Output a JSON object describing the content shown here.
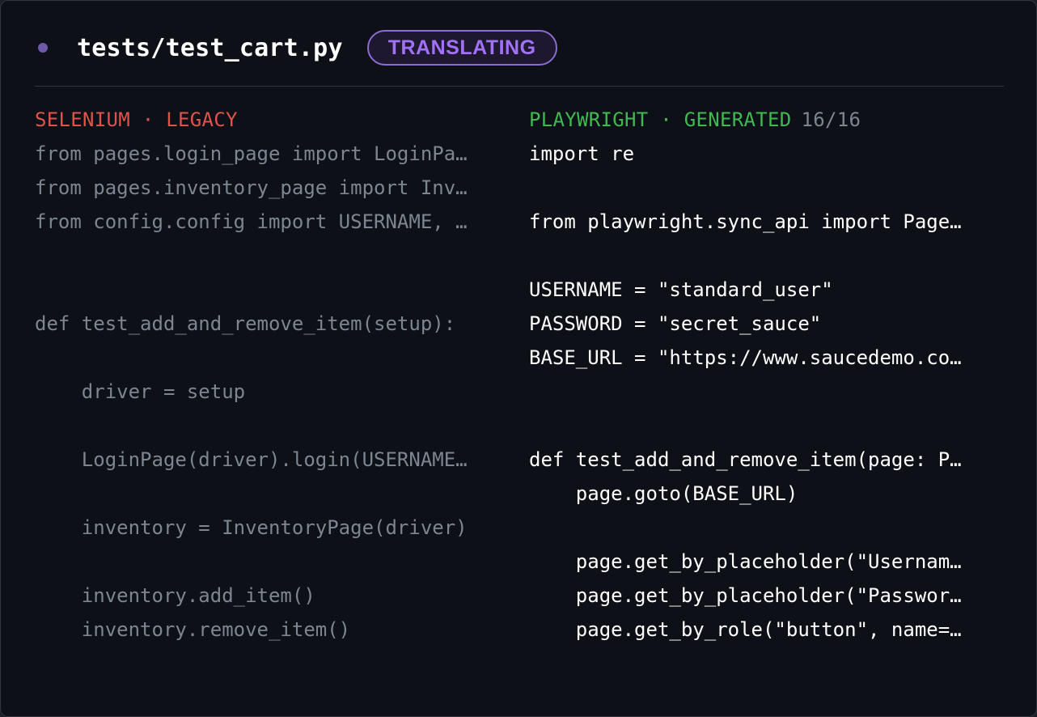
{
  "colors": {
    "accent_purple": "#a371f7",
    "status_dot": "#6e5aa8",
    "badge_border": "#8b6cd0",
    "badge_bg": "#1d1830",
    "legacy_red": "#e0534a",
    "generated_green": "#3fb950",
    "muted_text": "#7d8590",
    "code_white": "#ffffff"
  },
  "header": {
    "dot_icon": "status-dot-icon",
    "filename": "tests/test_cart.py",
    "status_badge": "TRANSLATING"
  },
  "left_pane": {
    "title": "SELENIUM · LEGACY",
    "lines": [
      "from pages.login_page import LoginPa…",
      "from pages.inventory_page import Inv…",
      "from config.config import USERNAME, …",
      "",
      "",
      "def test_add_and_remove_item(setup):",
      "",
      "    driver = setup",
      "",
      "    LoginPage(driver).login(USERNAME…",
      "",
      "    inventory = InventoryPage(driver)",
      "",
      "    inventory.add_item()",
      "    inventory.remove_item()"
    ]
  },
  "right_pane": {
    "title": "PLAYWRIGHT · GENERATED",
    "progress": "16/16",
    "lines": [
      "import re",
      "",
      "from playwright.sync_api import Page…",
      "",
      "USERNAME = \"standard_user\"",
      "PASSWORD = \"secret_sauce\"",
      "BASE_URL = \"https://www.saucedemo.co…",
      "",
      "",
      "def test_add_and_remove_item(page: P…",
      "    page.goto(BASE_URL)",
      "",
      "    page.get_by_placeholder(\"Usernam…",
      "    page.get_by_placeholder(\"Passwor…",
      "    page.get_by_role(\"button\", name=…"
    ]
  }
}
